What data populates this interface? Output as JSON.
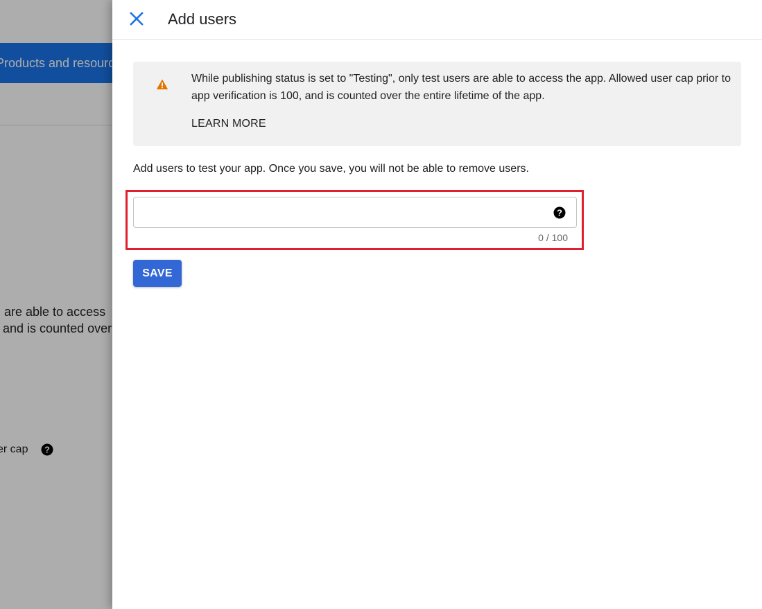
{
  "background": {
    "blue_button_label": "Products and resources",
    "text_line_1": "are able to access",
    "text_line_2": "and is counted over",
    "small_label": "er cap"
  },
  "panel": {
    "title": "Add users",
    "notice": {
      "text": "While publishing status is set to \"Testing\", only test users are able to access the app. Allowed user cap prior to app verification is 100, and is counted over the entire lifetime of the app.",
      "learn_more": "LEARN MORE"
    },
    "description": "Add users to test your app. Once you save, you will not be able to remove users.",
    "input": {
      "value": "",
      "counter": "0 / 100"
    },
    "save_label": "SAVE"
  },
  "colors": {
    "accent": "#3367d6",
    "close_icon": "#1a73e8",
    "warning": "#e37400",
    "highlight": "#e0202c"
  },
  "icons": {
    "close": "close-icon",
    "warning": "warning-icon",
    "help": "help-icon"
  }
}
